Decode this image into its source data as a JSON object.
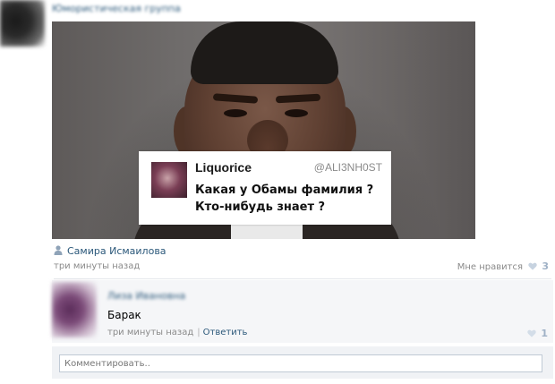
{
  "group": {
    "name": "Юмористическая группа"
  },
  "post": {
    "tweet": {
      "name": "Liquorice",
      "handle": "@ALI3NH0ST",
      "line1": "Какая у Обамы фамилия ?",
      "line2": "Кто-нибудь знает ?"
    },
    "author": "Самира Исмаилова",
    "time": "три минуты назад",
    "likes_label": "Мне нравится",
    "likes_count": "3"
  },
  "comment": {
    "author": "Лиза Ивановна",
    "text": "Барак",
    "time": "три минуты назад",
    "reply_label": "Ответить",
    "likes_count": "1"
  },
  "input": {
    "placeholder": "Комментировать.."
  },
  "colors": {
    "link": "#2b587a",
    "meta": "#8a8a8a",
    "like_count": "#9fb1c6"
  },
  "icons": [
    "person-icon",
    "heart-icon"
  ]
}
